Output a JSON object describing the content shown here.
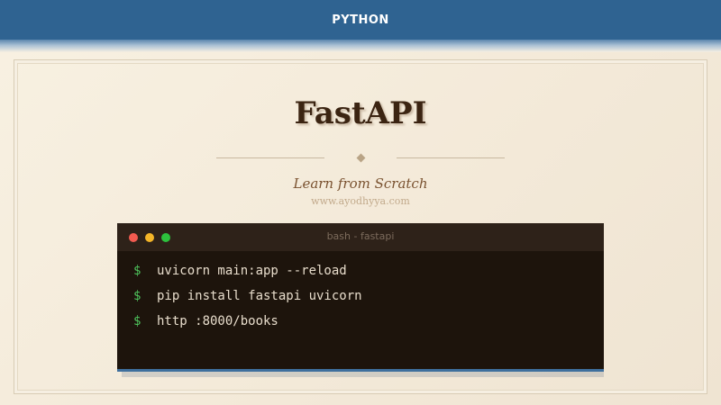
{
  "header": {
    "category": "PYTHON"
  },
  "hero": {
    "title": "FastAPI",
    "subtitle": "Learn from Scratch",
    "website": "www.ayodhyya.com"
  },
  "terminal": {
    "title": "bash - fastapi",
    "window_controls": [
      "close-dot",
      "minimize-dot",
      "maximize-dot"
    ],
    "prompt": "$",
    "commands": [
      "uvicorn main:app --reload",
      "pip install fastapi uvicorn",
      "http :8000/books"
    ]
  },
  "colors": {
    "header_bg": "#2f6391",
    "title": "#3b2412",
    "subtitle": "#7a5230",
    "terminal_bg": "#1d140c",
    "prompt": "#4ec45c",
    "command_text": "#e8ddcc"
  }
}
